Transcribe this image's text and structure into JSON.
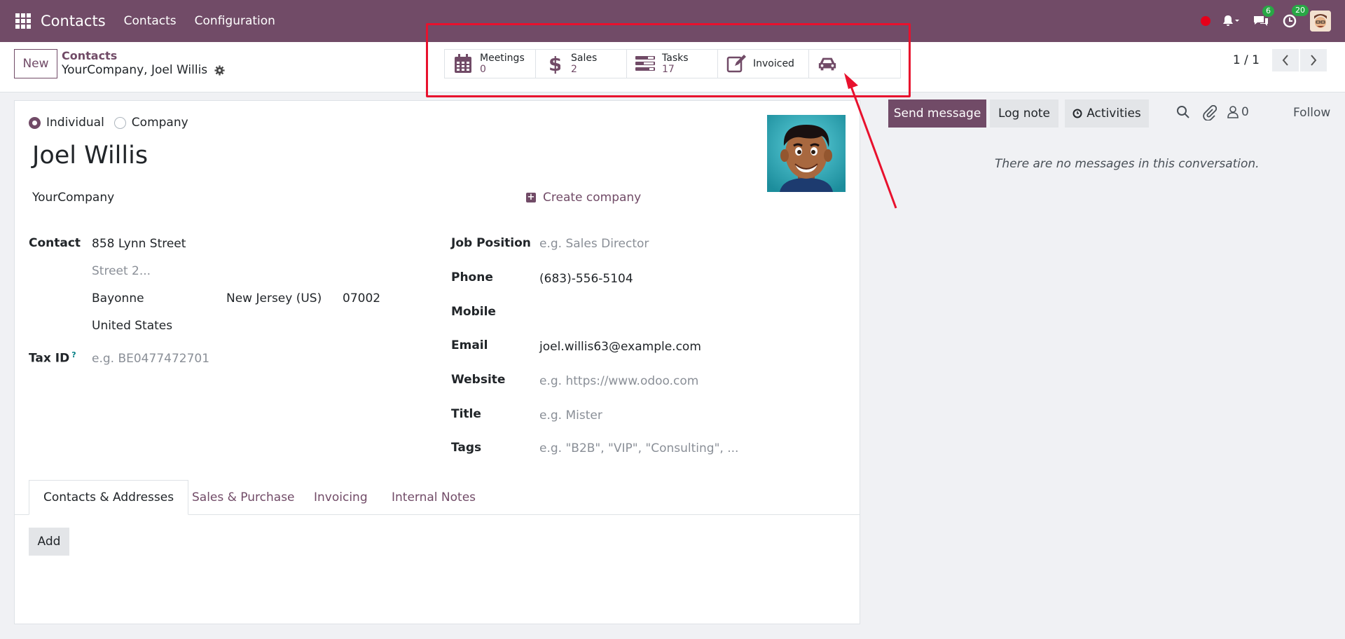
{
  "navbar": {
    "brand": "Contacts",
    "menu": [
      "Contacts",
      "Configuration"
    ],
    "chat_badge": "6",
    "activity_badge": "20"
  },
  "control": {
    "new_label": "New",
    "breadcrumb_parent": "Contacts",
    "breadcrumb_current": "YourCompany, Joel Willis",
    "pager": "1 / 1"
  },
  "smart_buttons": [
    {
      "label": "Meetings",
      "value": "0",
      "icon": "calendar-icon"
    },
    {
      "label": "Sales",
      "value": "2",
      "icon": "dollar-icon"
    },
    {
      "label": "Tasks",
      "value": "17",
      "icon": "tasks-icon"
    },
    {
      "label": "Invoiced",
      "value": "",
      "icon": "edit-icon"
    },
    {
      "label": "",
      "value": "",
      "icon": "car-icon"
    }
  ],
  "form": {
    "type_individual": "Individual",
    "type_company": "Company",
    "name": "Joel Willis",
    "company": "YourCompany",
    "create_company": "Create company",
    "contact_label": "Contact",
    "street": "858 Lynn Street",
    "street2_placeholder": "Street 2...",
    "city": "Bayonne",
    "state": "New Jersey (US)",
    "zip": "07002",
    "country": "United States",
    "tax_label": "Tax ID",
    "tax_help": "?",
    "tax_placeholder": "e.g. BE0477472701",
    "job_label": "Job Position",
    "job_placeholder": "e.g. Sales Director",
    "phone_label": "Phone",
    "phone": "(683)-556-5104",
    "mobile_label": "Mobile",
    "email_label": "Email",
    "email": "joel.willis63@example.com",
    "website_label": "Website",
    "website_placeholder": "e.g. https://www.odoo.com",
    "title_label": "Title",
    "title_placeholder": "e.g. Mister",
    "tags_label": "Tags",
    "tags_placeholder": "e.g. \"B2B\", \"VIP\", \"Consulting\", ..."
  },
  "tabs": [
    "Contacts & Addresses",
    "Sales & Purchase",
    "Invoicing",
    "Internal Notes"
  ],
  "add_label": "Add",
  "chatter": {
    "send_message": "Send message",
    "log_note": "Log note",
    "activities": "Activities",
    "followers_count": "0",
    "follow": "Follow",
    "empty": "There are no messages in this conversation."
  },
  "colors": {
    "brand": "#714b67",
    "highlight": "#e8112d",
    "badge": "#28a745"
  }
}
